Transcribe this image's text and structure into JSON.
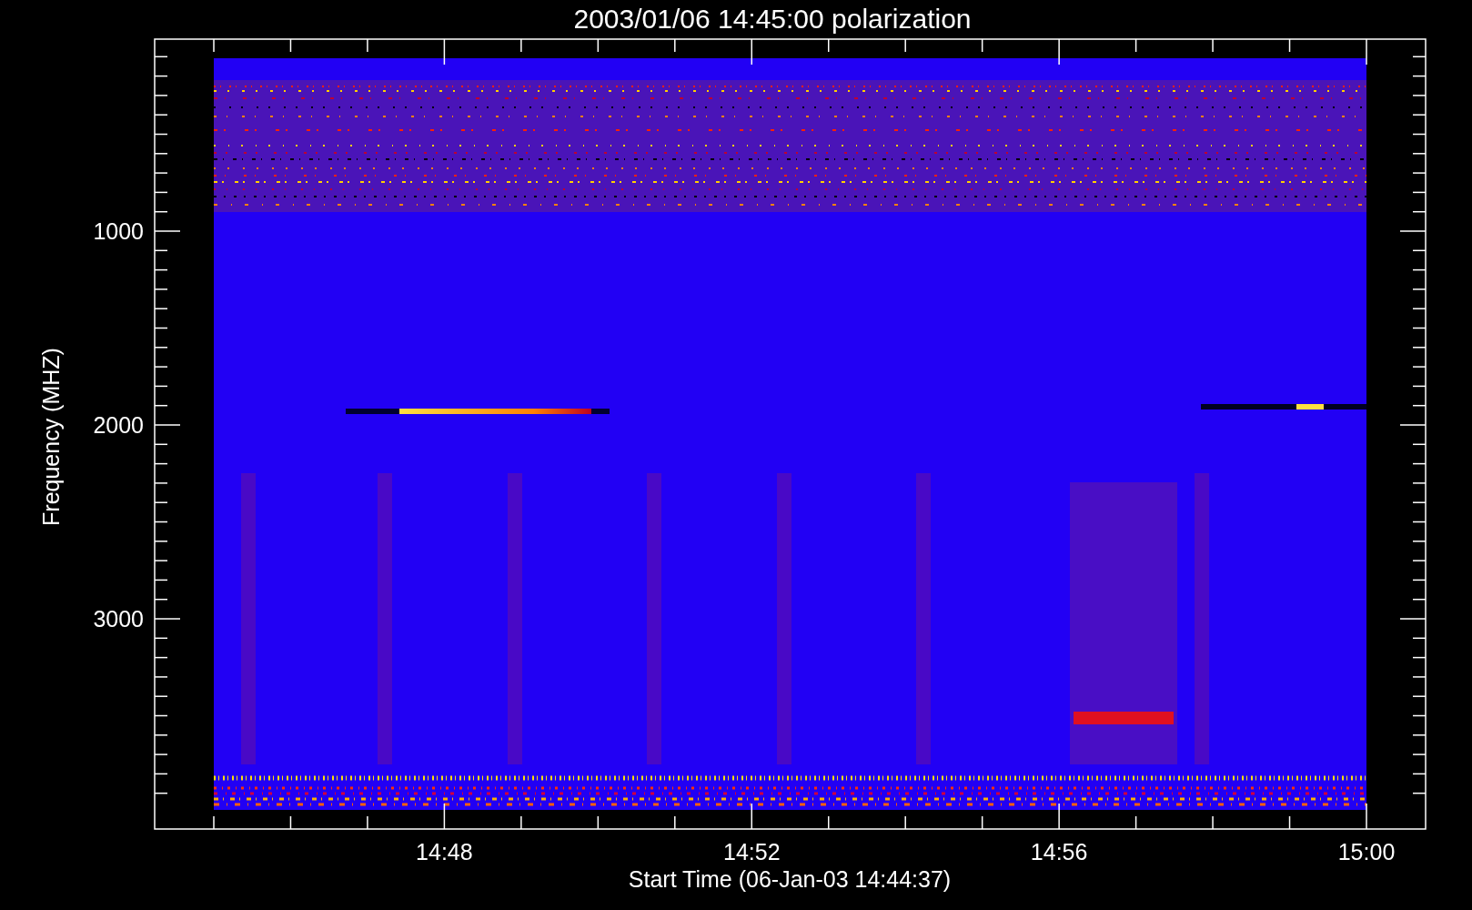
{
  "title": "2003/01/06 14:45:00 polarization",
  "plot": {
    "ylabel": "Frequency (MHZ)",
    "xlabel": "Start Time (06-Jan-03 14:44:37)",
    "yticks": [
      "1000",
      "2000",
      "3000"
    ],
    "xticks": [
      "14:48",
      "14:52",
      "14:56",
      "15:00"
    ]
  }
}
